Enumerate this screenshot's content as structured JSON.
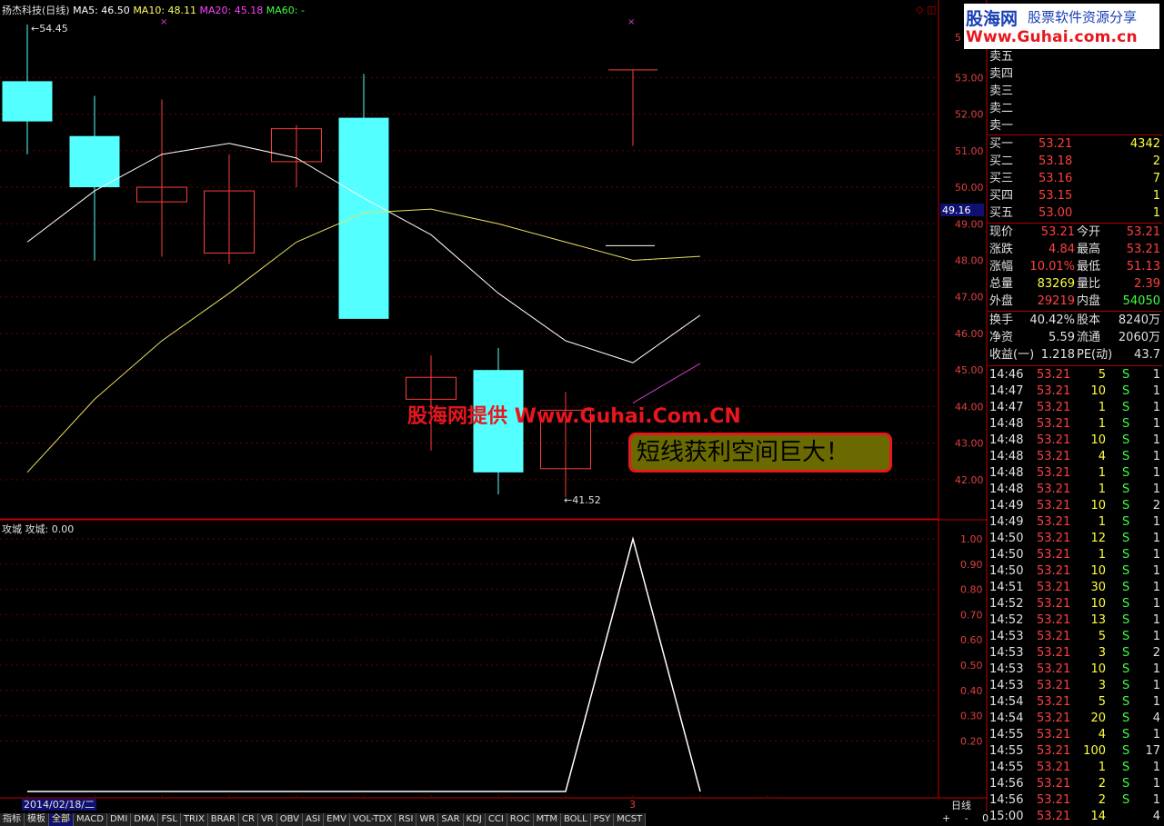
{
  "header": {
    "stock": "扬杰科技(日线)",
    "ma5": "MA5: 46.50",
    "ma10": "MA10: 48.11",
    "ma20": "MA20: 45.18",
    "ma60": "MA60: -",
    "high_label": "54.45",
    "low_label": "41.52",
    "current_price_tag": "49.16",
    "window_icons": "◇ ◫"
  },
  "price_axis": [
    "53.00",
    "52.00",
    "51.00",
    "50.00",
    "49.00",
    "48.00",
    "47.00",
    "46.00",
    "45.00",
    "44.00",
    "43.00",
    "42.00"
  ],
  "price_axis_top": "5",
  "indicator": {
    "title": "攻城",
    "value": "攻城: 0.00",
    "axis": [
      "1.00",
      "0.90",
      "0.80",
      "0.70",
      "0.60",
      "0.50",
      "0.40",
      "0.30",
      "0.20"
    ]
  },
  "bottom": {
    "date": "2014/02/18/二",
    "marker": "3",
    "period": "日线",
    "zoom": "+ - 0"
  },
  "tabs": [
    "指标",
    "模板",
    "全部",
    "MACD",
    "DMI",
    "DMA",
    "FSL",
    "TRIX",
    "BRAR",
    "CR",
    "VR",
    "OBV",
    "ASI",
    "EMV",
    "VOL-TDX",
    "RSI",
    "WR",
    "SAR",
    "KDJ",
    "CCI",
    "ROC",
    "MTM",
    "BOLL",
    "PSY",
    "MCST"
  ],
  "watermark": "股海网提供 Www.Guhai.Com.CN",
  "callout": "短线获利空间巨大！",
  "logo": {
    "brand": "股海网",
    "tagline": "股票软件资源分享",
    "url": "Www.Guhai.com.cn"
  },
  "sell_orders": [
    {
      "label": "卖五"
    },
    {
      "label": "卖四"
    },
    {
      "label": "卖三"
    },
    {
      "label": "卖二"
    },
    {
      "label": "卖一"
    }
  ],
  "buy_orders": [
    {
      "label": "买一",
      "price": "53.21",
      "vol": "4342"
    },
    {
      "label": "买二",
      "price": "53.18",
      "vol": "2"
    },
    {
      "label": "买三",
      "price": "53.16",
      "vol": "7"
    },
    {
      "label": "买四",
      "price": "53.15",
      "vol": "1"
    },
    {
      "label": "买五",
      "price": "53.00",
      "vol": "1"
    }
  ],
  "quote": [
    {
      "l1": "现价",
      "v1": "53.21",
      "l2": "今开",
      "v2": "53.21",
      "c1": "#ff4040",
      "c2": "#ff4040"
    },
    {
      "l1": "涨跌",
      "v1": "4.84",
      "l2": "最高",
      "v2": "53.21",
      "c1": "#ff4040",
      "c2": "#ff4040"
    },
    {
      "l1": "涨幅",
      "v1": "10.01%",
      "l2": "最低",
      "v2": "51.13",
      "c1": "#ff4040",
      "c2": "#ff4040"
    },
    {
      "l1": "总量",
      "v1": "83269",
      "l2": "量比",
      "v2": "2.39",
      "c1": "#ffff40",
      "c2": "#ff4040"
    },
    {
      "l1": "外盘",
      "v1": "29219",
      "l2": "内盘",
      "v2": "54050",
      "c1": "#ff4040",
      "c2": "#40ff40"
    }
  ],
  "fundamentals": [
    {
      "l1": "换手",
      "v1": "40.42%",
      "l2": "股本",
      "v2": "8240万"
    },
    {
      "l1": "净资",
      "v1": "5.59",
      "l2": "流通",
      "v2": "2060万"
    },
    {
      "l1": "收益(一)",
      "v1": "1.218",
      "l2": "PE(动)",
      "v2": "43.7"
    }
  ],
  "ticks": [
    {
      "t": "14:46",
      "p": "53.21",
      "v": "5",
      "s": "S",
      "n": "1"
    },
    {
      "t": "14:47",
      "p": "53.21",
      "v": "10",
      "s": "S",
      "n": "1"
    },
    {
      "t": "14:47",
      "p": "53.21",
      "v": "1",
      "s": "S",
      "n": "1"
    },
    {
      "t": "14:48",
      "p": "53.21",
      "v": "1",
      "s": "S",
      "n": "1"
    },
    {
      "t": "14:48",
      "p": "53.21",
      "v": "10",
      "s": "S",
      "n": "1"
    },
    {
      "t": "14:48",
      "p": "53.21",
      "v": "4",
      "s": "S",
      "n": "1"
    },
    {
      "t": "14:48",
      "p": "53.21",
      "v": "1",
      "s": "S",
      "n": "1"
    },
    {
      "t": "14:48",
      "p": "53.21",
      "v": "1",
      "s": "S",
      "n": "1"
    },
    {
      "t": "14:49",
      "p": "53.21",
      "v": "10",
      "s": "S",
      "n": "2"
    },
    {
      "t": "14:49",
      "p": "53.21",
      "v": "1",
      "s": "S",
      "n": "1"
    },
    {
      "t": "14:50",
      "p": "53.21",
      "v": "12",
      "s": "S",
      "n": "1"
    },
    {
      "t": "14:50",
      "p": "53.21",
      "v": "1",
      "s": "S",
      "n": "1"
    },
    {
      "t": "14:50",
      "p": "53.21",
      "v": "10",
      "s": "S",
      "n": "1"
    },
    {
      "t": "14:51",
      "p": "53.21",
      "v": "30",
      "s": "S",
      "n": "1"
    },
    {
      "t": "14:52",
      "p": "53.21",
      "v": "10",
      "s": "S",
      "n": "1"
    },
    {
      "t": "14:52",
      "p": "53.21",
      "v": "13",
      "s": "S",
      "n": "1"
    },
    {
      "t": "14:53",
      "p": "53.21",
      "v": "5",
      "s": "S",
      "n": "1"
    },
    {
      "t": "14:53",
      "p": "53.21",
      "v": "3",
      "s": "S",
      "n": "2"
    },
    {
      "t": "14:53",
      "p": "53.21",
      "v": "10",
      "s": "S",
      "n": "1"
    },
    {
      "t": "14:53",
      "p": "53.21",
      "v": "3",
      "s": "S",
      "n": "1"
    },
    {
      "t": "14:54",
      "p": "53.21",
      "v": "5",
      "s": "S",
      "n": "1"
    },
    {
      "t": "14:54",
      "p": "53.21",
      "v": "20",
      "s": "S",
      "n": "4"
    },
    {
      "t": "14:55",
      "p": "53.21",
      "v": "4",
      "s": "S",
      "n": "1"
    },
    {
      "t": "14:55",
      "p": "53.21",
      "v": "100",
      "s": "S",
      "n": "17"
    },
    {
      "t": "14:55",
      "p": "53.21",
      "v": "1",
      "s": "S",
      "n": "1"
    },
    {
      "t": "14:56",
      "p": "53.21",
      "v": "2",
      "s": "S",
      "n": "1"
    },
    {
      "t": "14:56",
      "p": "53.21",
      "v": "2",
      "s": "S",
      "n": "1"
    },
    {
      "t": "15:00",
      "p": "53.21",
      "v": "14",
      "s": "",
      "n": "4"
    }
  ],
  "chart_data": {
    "type": "candlestick",
    "price_range": [
      41.5,
      54.5
    ],
    "candles": [
      {
        "open": 51.8,
        "close": 52.9,
        "high": 54.45,
        "low": 50.9,
        "color": "cyan"
      },
      {
        "open": 50.0,
        "close": 51.4,
        "high": 52.5,
        "low": 48.0,
        "color": "cyan"
      },
      {
        "open": 49.6,
        "close": 50.0,
        "high": 52.4,
        "low": 48.1,
        "color": "red"
      },
      {
        "open": 48.2,
        "close": 49.9,
        "high": 50.9,
        "low": 47.9,
        "color": "red"
      },
      {
        "open": 50.7,
        "close": 51.6,
        "high": 51.7,
        "low": 50.0,
        "color": "red"
      },
      {
        "open": 46.4,
        "close": 51.9,
        "high": 53.1,
        "low": 46.4,
        "color": "cyan"
      },
      {
        "open": 44.2,
        "close": 44.8,
        "high": 45.4,
        "low": 42.8,
        "color": "red"
      },
      {
        "open": 42.2,
        "close": 45.0,
        "high": 45.6,
        "low": 41.6,
        "color": "cyan"
      },
      {
        "open": 42.3,
        "close": 43.9,
        "high": 44.4,
        "low": 41.52,
        "color": "red"
      },
      {
        "open": 53.21,
        "close": 53.21,
        "high": 53.21,
        "low": 51.13,
        "color": "red"
      }
    ],
    "ma5": [
      48.5,
      49.9,
      50.9,
      51.2,
      50.8,
      49.7,
      48.7,
      47.1,
      45.8,
      45.2,
      46.5
    ],
    "ma10": [
      42.2,
      44.2,
      45.8,
      47.1,
      48.5,
      49.3,
      49.4,
      49.0,
      48.5,
      48.0,
      48.11
    ],
    "ma20": [
      44.1,
      45.18
    ],
    "indicator_values": [
      0,
      0,
      0,
      0,
      0,
      0,
      0,
      0,
      0,
      1,
      0,
      0
    ]
  }
}
